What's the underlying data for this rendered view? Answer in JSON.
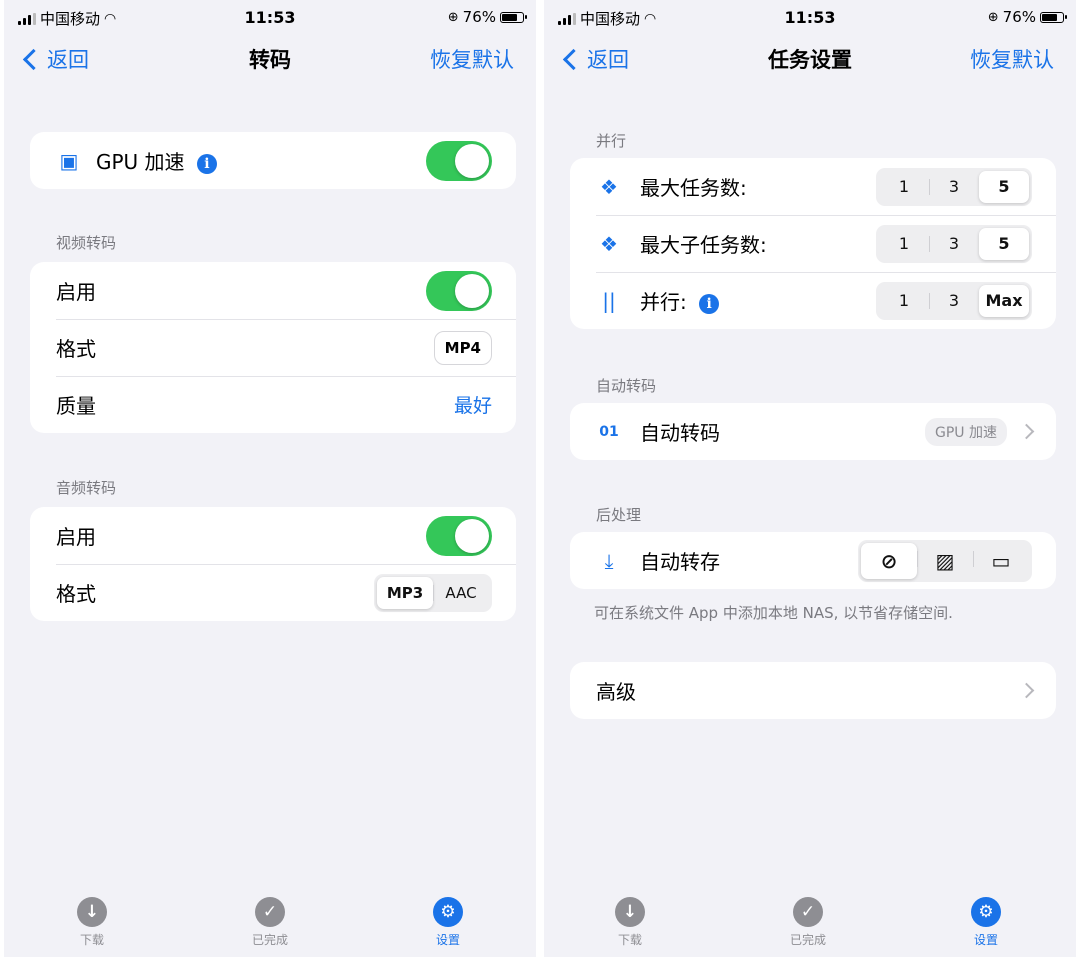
{
  "status": {
    "carrier": "中国移动",
    "time": "11:53",
    "battery": "76%",
    "battery_level": 0.76
  },
  "left": {
    "nav": {
      "back": "返回",
      "title": "转码",
      "reset": "恢复默认"
    },
    "gpu": {
      "label": "GPU 加速",
      "info": "i",
      "icon": "chip-icon",
      "enabled": true
    },
    "video": {
      "section": "视频转码",
      "enable_label": "启用",
      "enabled": true,
      "format_label": "格式",
      "format_value": "MP4",
      "quality_label": "质量",
      "quality_value": "最好"
    },
    "audio": {
      "section": "音频转码",
      "enable_label": "启用",
      "enabled": true,
      "format_label": "格式",
      "formats": [
        "MP3",
        "AAC"
      ],
      "selected": "MP3"
    }
  },
  "right": {
    "nav": {
      "back": "返回",
      "title": "任务设置",
      "reset": "恢复默认"
    },
    "parallel": {
      "section": "并行",
      "max_tasks": {
        "label": "最大任务数:",
        "options": [
          "1",
          "3",
          "5"
        ],
        "selected": "5"
      },
      "max_subtasks": {
        "label": "最大子任务数:",
        "options": [
          "1",
          "3",
          "5"
        ],
        "selected": "5"
      },
      "parallel": {
        "label": "并行:",
        "info": "i",
        "options": [
          "1",
          "3",
          "Max"
        ],
        "selected": "Max"
      }
    },
    "auto_transcode": {
      "section": "自动转码",
      "label": "自动转码",
      "badge": "GPU 加速"
    },
    "post": {
      "section": "后处理",
      "label": "自动转存",
      "options": [
        "none-icon",
        "photos-icon",
        "folder-icon"
      ],
      "selected": "none-icon",
      "note": "可在系统文件 App 中添加本地 NAS, 以节省存储空间."
    },
    "advanced": {
      "label": "高级"
    }
  },
  "tabs": [
    {
      "label": "下载",
      "icon": "download-icon",
      "active": false
    },
    {
      "label": "已完成",
      "icon": "check-icon",
      "active": false
    },
    {
      "label": "设置",
      "icon": "settings-icon",
      "active": true
    }
  ],
  "colors": {
    "accent": "#1a73e8",
    "toggle_on": "#34c759",
    "background": "#f2f2f7"
  }
}
